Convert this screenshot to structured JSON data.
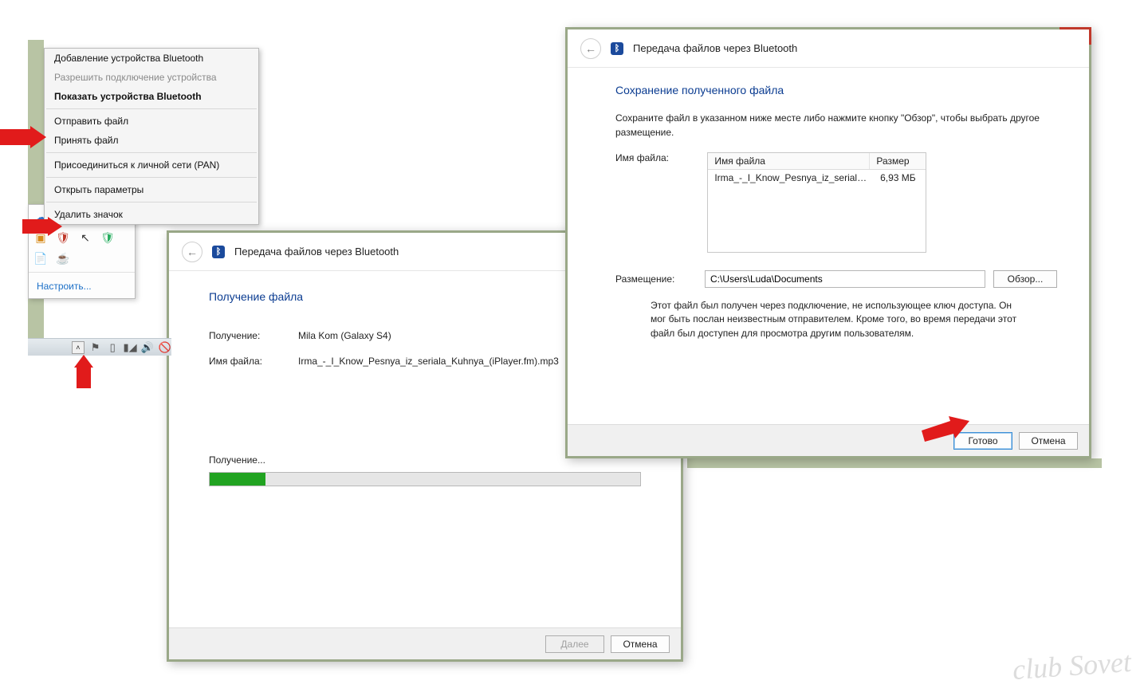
{
  "context_menu": {
    "items": [
      "Добавление устройства Bluetooth",
      "Разрешить подключение устройства",
      "Показать устройства Bluetooth",
      "Отправить файл",
      "Принять файл",
      "Присоединиться к личной сети (PAN)",
      "Открыть параметры",
      "Удалить значок"
    ]
  },
  "tray": {
    "customize": "Настроить..."
  },
  "receive_window": {
    "title": "Передача файлов через Bluetooth",
    "heading": "Получение файла",
    "from_label": "Получение:",
    "from_value": "Mila Kom (Galaxy S4)",
    "filename_label": "Имя файла:",
    "filename_value": "Irma_-_I_Know_Pesnya_iz_seriala_Kuhnya_(iPlayer.fm).mp3",
    "progress_label": "Получение...",
    "next": "Далее",
    "cancel": "Отмена"
  },
  "save_window": {
    "title": "Передача файлов через Bluetooth",
    "heading": "Сохранение полученного файла",
    "instruction": "Сохраните файл в указанном ниже месте либо нажмите кнопку \"Обзор\", чтобы выбрать другое размещение.",
    "filename_label": "Имя файла:",
    "col_name": "Имя файла",
    "col_size": "Размер",
    "row_name": "Irma_-_I_Know_Pesnya_iz_seriala_K...",
    "row_size": "6,93 МБ",
    "location_label": "Размещение:",
    "location_value": "C:\\Users\\Luda\\Documents",
    "browse": "Обзор...",
    "warning": "Этот файл был получен через подключение, не использующее ключ доступа. Он мог быть послан неизвестным отправителем. Кроме того, во время передачи этот файл был доступен для просмотра другим пользователям.",
    "done": "Готово",
    "cancel": "Отмена"
  },
  "watermark": "club Sovet"
}
